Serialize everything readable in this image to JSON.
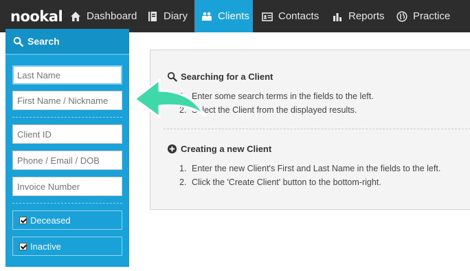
{
  "app": {
    "logo": "nookal"
  },
  "nav": {
    "items": [
      {
        "label": "Dashboard",
        "icon": "home-icon"
      },
      {
        "label": "Diary",
        "icon": "diary-icon"
      },
      {
        "label": "Clients",
        "icon": "clients-icon",
        "active": true
      },
      {
        "label": "Contacts",
        "icon": "contacts-icon"
      },
      {
        "label": "Reports",
        "icon": "reports-icon"
      },
      {
        "label": "Practice",
        "icon": "globe-icon"
      }
    ]
  },
  "sidebar": {
    "title": "Search",
    "fields": {
      "last_name": "Last Name",
      "first_name": "First Name / Nickname",
      "client_id": "Client ID",
      "contact": "Phone / Email / DOB",
      "invoice": "Invoice Number"
    },
    "checkboxes": {
      "deceased": "Deceased",
      "inactive": "Inactive"
    }
  },
  "help": {
    "searching": {
      "title": "Searching for a Client",
      "steps": [
        "Enter some search terms in the fields to the left.",
        "Select the Client from the displayed results."
      ]
    },
    "creating": {
      "title": "Creating a new Client",
      "steps": [
        "Enter the new Client's First and Last Name in the fields to the left.",
        "Click the 'Create Client' button to the bottom-right."
      ]
    }
  },
  "colors": {
    "nav_bg": "#2d2d2d",
    "accent": "#1aa1d8",
    "arrow": "#3fd8a8"
  }
}
